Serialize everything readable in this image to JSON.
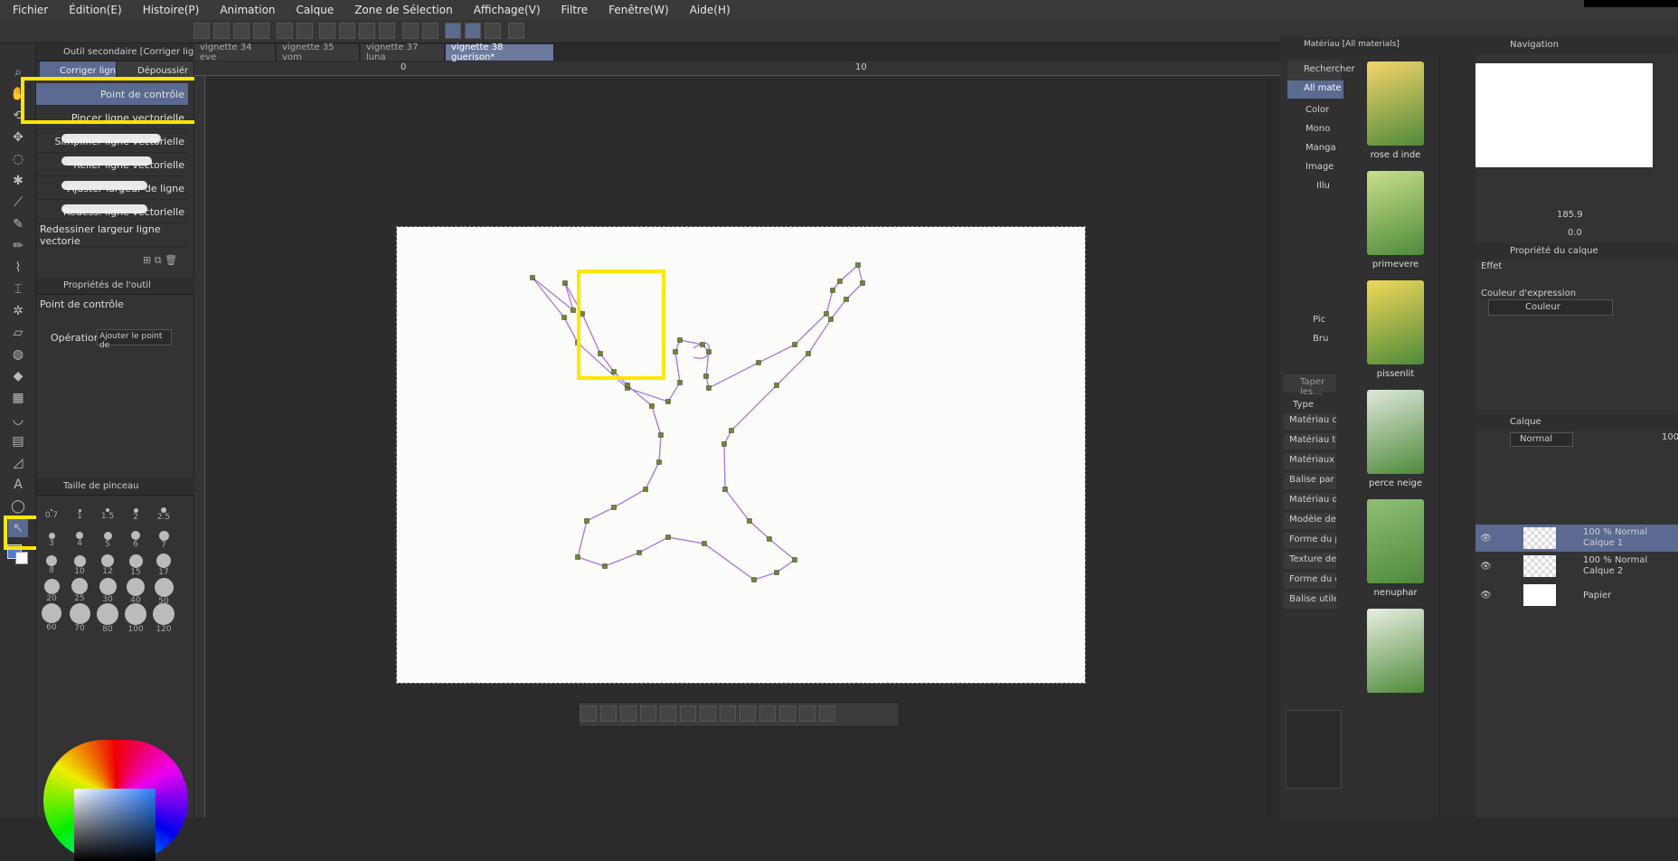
{
  "menu": [
    "Fichier",
    "Édition(E)",
    "Histoire(P)",
    "Animation",
    "Calque",
    "Zone de Sélection",
    "Affichage(V)",
    "Filtre",
    "Fenêtre(W)",
    "Aide(H)"
  ],
  "subtool": {
    "header": "Outil secondaire [Corriger lig",
    "tab1": "Corriger lign",
    "tab2": "Dépoussiér",
    "items": [
      "Point de contrôle",
      "Pincer ligne vectorielle",
      "Simplifier ligne vectorielle",
      "Relier ligne vectorielle",
      "Ajuster largeur de ligne",
      "Redess. ligne vectorielle",
      "Redessiner largeur ligne vectorie"
    ],
    "props_header": "Propriétés de l'outil",
    "props_title": "Point de contrôle",
    "operation_label": "Opération",
    "operation_value": "Ajouter le point de",
    "brush_header": "Taille de pinceau",
    "brush_sizes": [
      "0.7",
      "1",
      "1.5",
      "2",
      "2.5",
      "3",
      "4",
      "5",
      "6",
      "7",
      "8",
      "10",
      "12",
      "15",
      "17",
      "20",
      "25",
      "30",
      "40",
      "50",
      "60",
      "70",
      "80",
      "100",
      "120"
    ]
  },
  "canvas": {
    "tabs": [
      "vignette 34 eve",
      "vignette 35 vom",
      "vignette 37 luna",
      "vignette 38 guerison*"
    ],
    "ruler": [
      "0",
      "10"
    ]
  },
  "material": {
    "header": "Matériau [All materials]",
    "search": "Rechercher",
    "tree": [
      "All mate",
      "Color",
      "Mono",
      "Manga",
      "Image",
      "Illu",
      "Pic",
      "Bru"
    ],
    "tag_search": "Taper les...",
    "type_label": "Type",
    "types": [
      "Matériau cré",
      "Matériau télé",
      "Matériaux s",
      "Balise par ...",
      "Matériau d'Ir",
      "Modèle de",
      "Forme du p",
      "Texture de p",
      "Forme du c",
      "Balise utile"
    ],
    "thumbs": [
      "rose d inde",
      "primevere",
      "pissenlit",
      "perce neige",
      "nenuphar",
      ""
    ]
  },
  "nav": {
    "header": "Navigation",
    "zoom": "185.9",
    "rotate": "0.0"
  },
  "layerprop": {
    "header": "Propriété du calque",
    "effect": "Effet",
    "expr_label": "Couleur d'expression",
    "expr_value": "Couleur"
  },
  "layers": {
    "header": "Calque",
    "blend": "Normal",
    "opacity": "100",
    "items": [
      {
        "pct": "100 % Normal",
        "name": "Calque 1"
      },
      {
        "pct": "100 % Normal",
        "name": "Calque 2"
      },
      {
        "pct": "",
        "name": "Papier"
      }
    ]
  },
  "colors": {
    "accent": "#6c7a9c",
    "highlight": "#ffe600",
    "line": "#b07ad8"
  }
}
